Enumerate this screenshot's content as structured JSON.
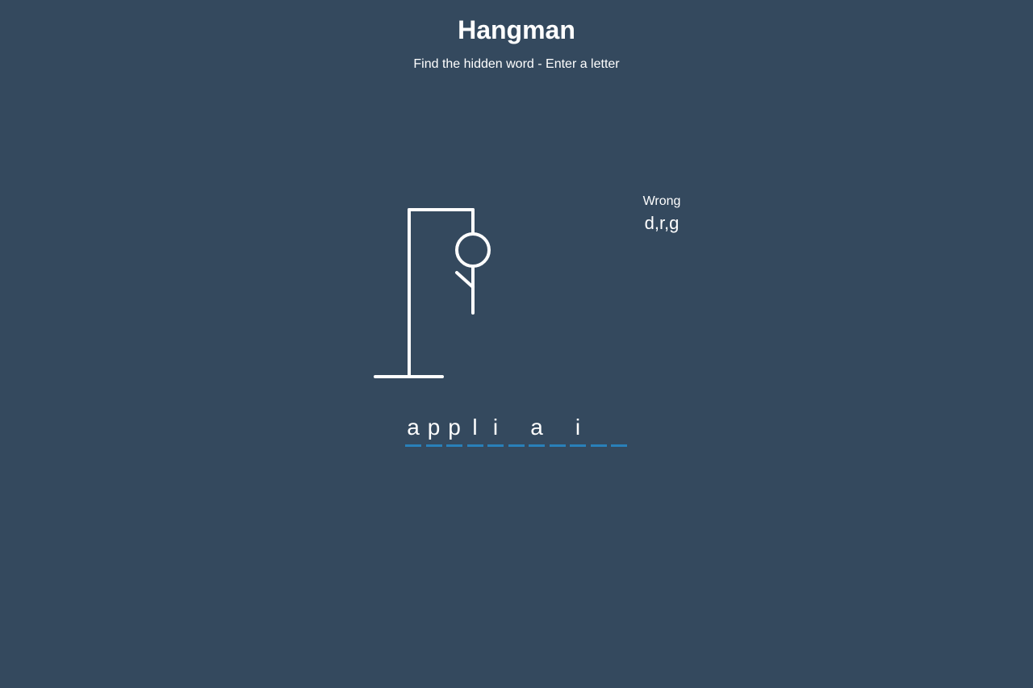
{
  "header": {
    "title": "Hangman",
    "subtitle": "Find the hidden word - Enter a letter"
  },
  "wrong": {
    "label": "Wrong",
    "letters": "d,r,g"
  },
  "word": {
    "slots": [
      "a",
      "p",
      "p",
      "l",
      "i",
      "",
      "a",
      "",
      "i",
      "",
      ""
    ]
  },
  "figure": {
    "visible_parts": [
      "head",
      "body",
      "left-arm"
    ]
  },
  "colors": {
    "background": "#34495e",
    "text": "#ffffff",
    "slot_underline": "#2980b9"
  }
}
